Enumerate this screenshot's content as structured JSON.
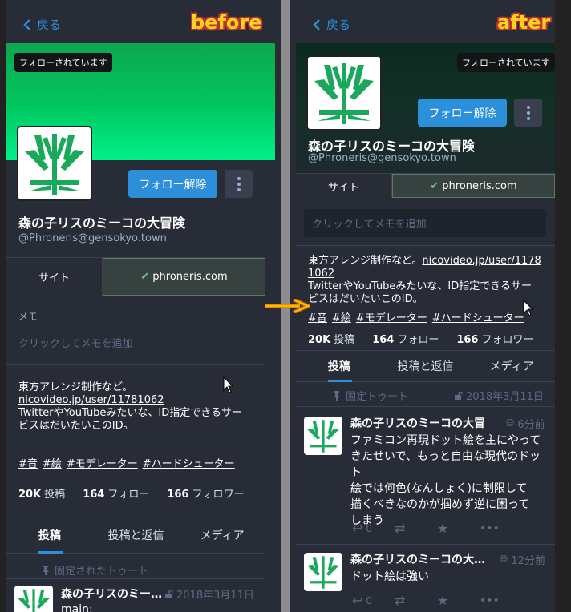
{
  "labels": {
    "before": "before",
    "after": "after"
  },
  "back_label": "戻る",
  "badge_followed": "フォローされています",
  "unfollow_label": "フォロー解除",
  "profile": {
    "name": "森の子リスのミーコの大冒険",
    "handle": "@Phroneris@gensokyo.town",
    "field_key": "サイト",
    "field_value": "phroneris.com"
  },
  "memo": {
    "label": "メモ",
    "placeholder": "クリックしてメモを追加"
  },
  "bio_before": {
    "line1": "東方アレンジ制作など。",
    "link": "nicovideo.jp/user/11781062",
    "line2": "TwitterやYouTubeみたいな、ID指定できるサー",
    "line3": "ビスはだいたいこのID。"
  },
  "bio_after": {
    "line1": "東方アレンジ制作など。",
    "link_a": "nicovideo.jp/user/1178",
    "link_b": "1062",
    "line2": "TwitterやYouTubeみたいな、ID指定できるサー",
    "line3": "ビスはだいたいこのID。"
  },
  "hashtags": [
    "#音",
    "#絵",
    "#モデレーター",
    "#ハードシューター"
  ],
  "stats": {
    "posts_count": "20K",
    "posts_label": "投稿",
    "following_count": "164",
    "following_label": "フォロー",
    "followers_count": "166",
    "followers_label": "フォロワー"
  },
  "tabs": [
    "投稿",
    "投稿と返信",
    "メディア"
  ],
  "pinned": {
    "before": "固定されたトゥート",
    "after": "固定トゥート"
  },
  "statuses_before": [
    {
      "name": "森の子リスのミー…",
      "time": "2018年3月11日",
      "text": "main:"
    }
  ],
  "statuses_after": [
    {
      "name": "森の子リスのミーコの大冒",
      "time": "6分前",
      "lines": [
        "ファミコン再現ドット絵を主にやって",
        "きたせいで、もっと自由な現代のドット",
        "絵では何色(なんしょく)に制限して",
        "描くべきなのかが掴めず逆に困って",
        "しまう"
      ],
      "replies": "0"
    },
    {
      "name": "森の子リスのミーコの大…",
      "time": "12分前",
      "lines": [
        "ドット絵は強い"
      ],
      "replies": "0"
    }
  ],
  "pinned_time_after": "2018年3月11日",
  "colors": {
    "accent": "#2b90d9",
    "bg": "#282c37",
    "header_green": "#00e07a",
    "label_yellow": "#ffd21e"
  }
}
